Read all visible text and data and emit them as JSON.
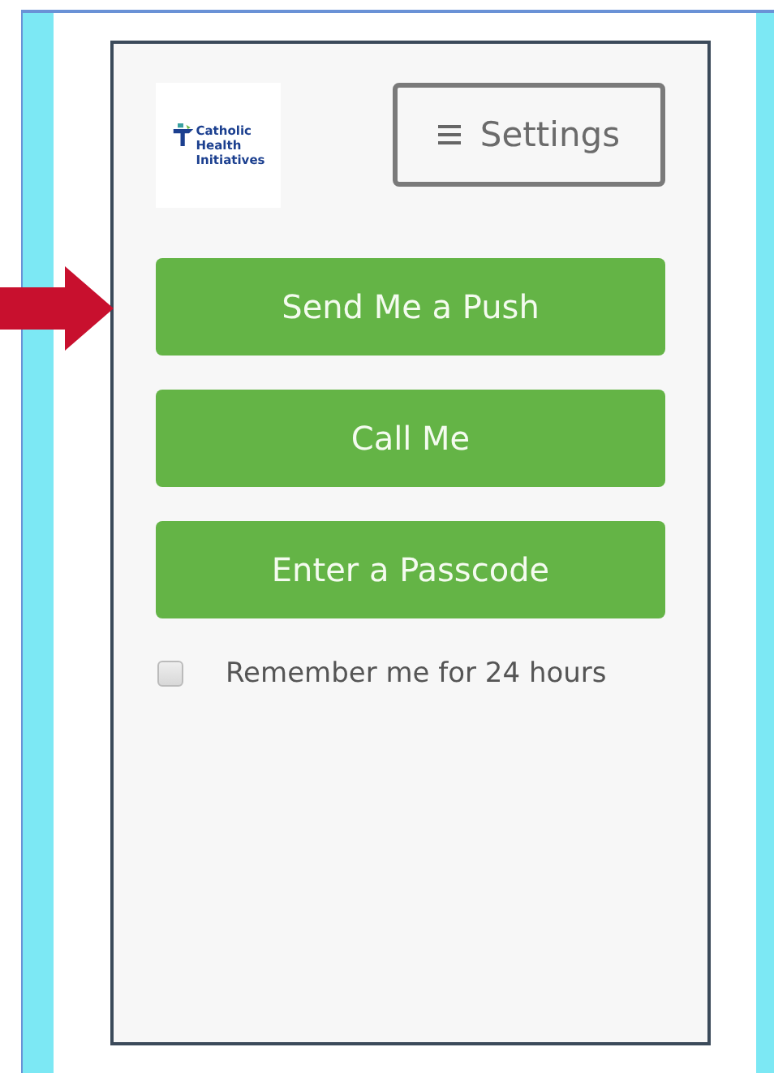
{
  "logo": {
    "lines": [
      "Catholic",
      "Health",
      "Initiatives"
    ]
  },
  "settings_button": {
    "label": "Settings"
  },
  "buttons": [
    {
      "label": "Send Me a Push",
      "pointed": true
    },
    {
      "label": "Call Me",
      "pointed": false
    },
    {
      "label": "Enter a Passcode",
      "pointed": false
    }
  ],
  "remember": {
    "label": "Remember me for 24 hours",
    "checked": false
  }
}
